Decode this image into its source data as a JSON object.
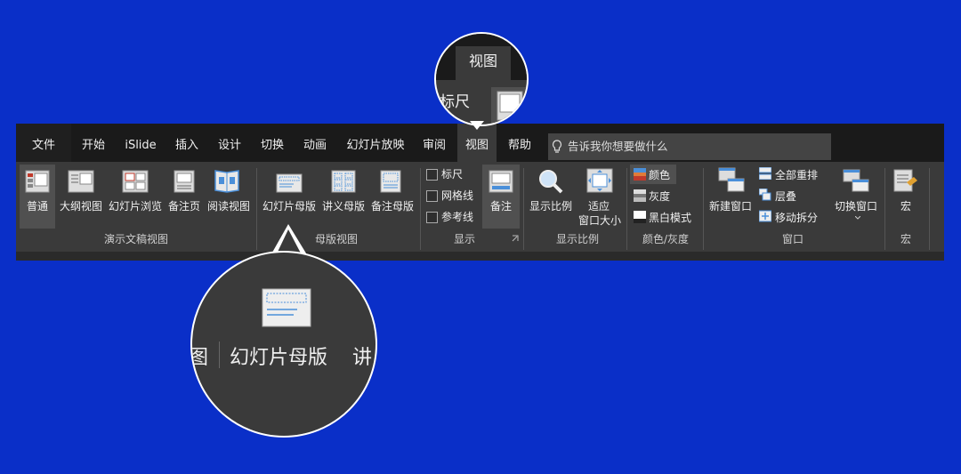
{
  "tabs": {
    "file": "文件",
    "home": "开始",
    "islide": "iSlide",
    "insert": "插入",
    "design": "设计",
    "transitions": "切换",
    "animations": "动画",
    "slideshow": "幻灯片放映",
    "review": "审阅",
    "view": "视图",
    "help": "帮助"
  },
  "tell_me": "告诉我你想要做什么",
  "groups": {
    "presentation_views": {
      "label": "演示文稿视图",
      "normal": "普通",
      "outline": "大纲视图",
      "sorter": "幻灯片浏览",
      "notes_page": "备注页",
      "reading": "阅读视图"
    },
    "master_views": {
      "label": "母版视图",
      "slide_master": "幻灯片母版",
      "handout_master": "讲义母版",
      "notes_master": "备注母版"
    },
    "show": {
      "label": "显示",
      "ruler": "标尺",
      "gridlines": "网格线",
      "guides": "参考线",
      "notes": "备注"
    },
    "zoom": {
      "label": "显示比例",
      "zoom": "显示比例",
      "fit_1": "适应",
      "fit_2": "窗口大小"
    },
    "color": {
      "label": "颜色/灰度",
      "color": "颜色",
      "grayscale": "灰度",
      "bw": "黑白模式"
    },
    "window": {
      "label": "窗口",
      "new_window": "新建窗口",
      "arrange_all": "全部重排",
      "cascade": "层叠",
      "move_split": "移动拆分",
      "switch_windows": "切换窗口"
    },
    "macros": {
      "label": "宏",
      "macros": "宏"
    }
  },
  "magnifier_top": {
    "tab": "视图",
    "partial": "标尺"
  },
  "magnifier_bottom": {
    "label": "幻灯片母版",
    "left_partial": "图",
    "right_partial": "讲"
  }
}
